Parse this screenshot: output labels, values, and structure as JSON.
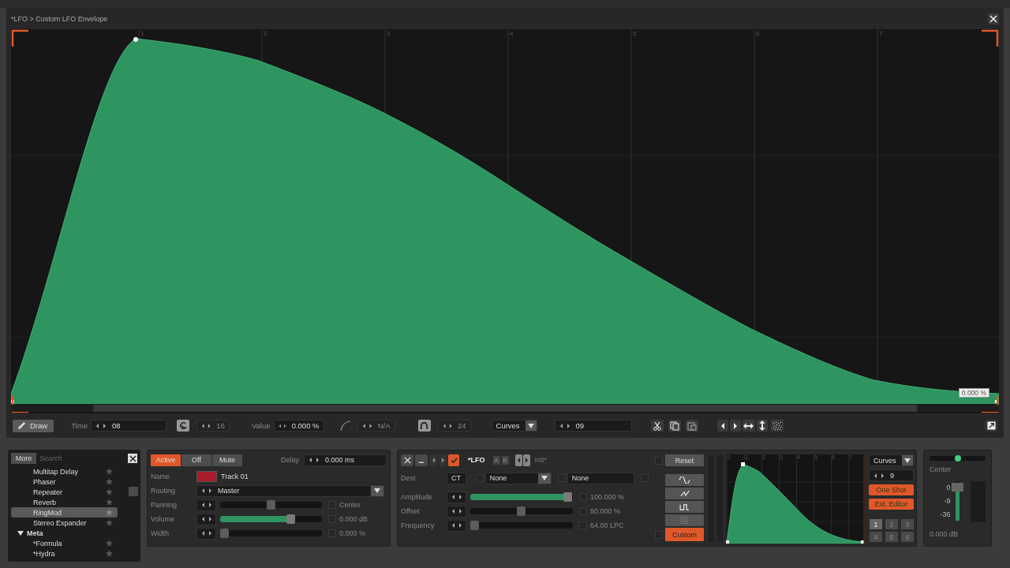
{
  "title": "*LFO > Custom LFO Envelope",
  "envelope": {
    "grid_labels": [
      "1",
      "2",
      "3",
      "4",
      "5",
      "6",
      "7"
    ],
    "value_tag": "0.000 %"
  },
  "toolbar": {
    "draw_button": {
      "label": "Draw",
      "selected": true
    },
    "time": {
      "label": "Time",
      "value": "08"
    },
    "grid": {
      "value": "16",
      "disabled": true
    },
    "value": {
      "label": "Value",
      "value": "0.000 %"
    },
    "curve": {
      "value": "N/A",
      "disabled": true
    },
    "snap": {
      "value": "24",
      "disabled": true
    },
    "mode": {
      "value": "Curves"
    },
    "points": {
      "value": "09"
    }
  },
  "browser": {
    "more": "More",
    "search_placeholder": "Search",
    "items": [
      {
        "label": "Multitap Delay",
        "selected": false
      },
      {
        "label": "Phaser",
        "selected": false
      },
      {
        "label": "Repeater",
        "selected": false
      },
      {
        "label": "Reverb",
        "selected": false
      },
      {
        "label": "RingMod",
        "selected": true
      },
      {
        "label": "Stereo Expander",
        "selected": false
      },
      {
        "label": "Meta",
        "selected": false,
        "expanded": true,
        "children": [
          {
            "label": "*Formula",
            "selected": false
          },
          {
            "label": "*Hydra",
            "selected": false
          }
        ]
      }
    ]
  },
  "track": {
    "modes": [
      {
        "label": "Active",
        "selected": true
      },
      {
        "label": "Off",
        "selected": false
      },
      {
        "label": "Mute",
        "selected": false
      }
    ],
    "delay": {
      "label": "Delay",
      "value": "0.000 ms"
    },
    "name": {
      "label": "Name",
      "value": "Track 01",
      "color": "#a81c2c"
    },
    "routing": {
      "label": "Routing",
      "value": "Master"
    },
    "sliders": [
      {
        "label": "Panning",
        "level": 0.5,
        "filled": false,
        "checked": false,
        "reading": "Center"
      },
      {
        "label": "Volume",
        "level": 0.72,
        "filled": true,
        "checked": false,
        "reading": "0.000 dB"
      },
      {
        "label": "Width",
        "level": 0,
        "filled": false,
        "checked": false,
        "reading": "0.000 %"
      }
    ]
  },
  "lfo": {
    "enabled": true,
    "name": "*LFO",
    "slots": [
      "A",
      "B"
    ],
    "preset": "Init*",
    "dest": {
      "label": "Dest.",
      "code": "CT",
      "target": "None",
      "param": "None",
      "checks": [
        false,
        false,
        false
      ]
    },
    "sliders": [
      {
        "label": "Amplitude",
        "level": 1,
        "filled": true,
        "checked": false,
        "reading": "100.000 %"
      },
      {
        "label": "Offset",
        "level": 0.5,
        "filled": false,
        "checked": false,
        "reading": "50.000 %"
      },
      {
        "label": "Frequency",
        "level": 0,
        "filled": false,
        "checked": false,
        "reading": "64.00 LPC"
      }
    ],
    "reset": "Reset",
    "side_checks": [
      false,
      false
    ],
    "shapes": [
      {
        "kind": "sine",
        "selected": false
      },
      {
        "kind": "saw",
        "selected": false
      },
      {
        "kind": "square",
        "selected": false
      },
      {
        "kind": "noise",
        "selected": false
      },
      {
        "kind": "custom",
        "label": "Custom",
        "selected": true
      }
    ]
  },
  "preview": {
    "grid_labels": [
      "0",
      "1",
      "2",
      "3",
      "4",
      "5",
      "6",
      "7"
    ],
    "mode": "Curves",
    "points": "9",
    "one_shot": {
      "label": "One Shot",
      "on": true
    },
    "ext_editor": "Ext. Editor",
    "presets": [
      {
        "label": "1",
        "selected": true
      },
      {
        "label": "2",
        "selected": false
      },
      {
        "label": "3",
        "selected": false
      },
      {
        "label": "4",
        "selected": false
      },
      {
        "label": "5",
        "selected": false
      },
      {
        "label": "6",
        "selected": false
      }
    ]
  },
  "output": {
    "pan": {
      "level": 0.5,
      "reading": "Center"
    },
    "fader": {
      "level": 0.85,
      "ticks": [
        "0",
        "-9",
        "-36"
      ],
      "reading": "0.000 dB"
    }
  }
}
